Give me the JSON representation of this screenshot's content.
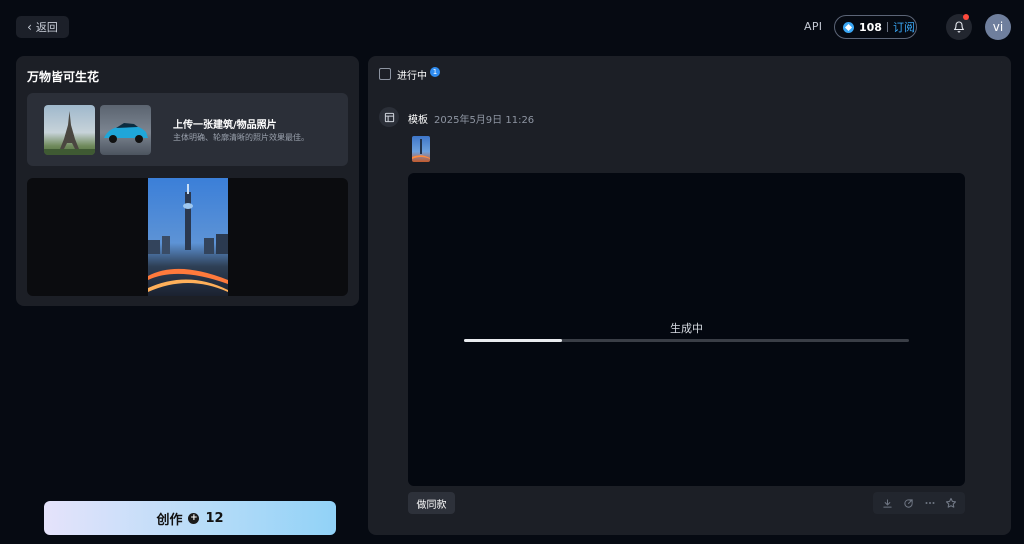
{
  "header": {
    "back_label": "返回",
    "api_label": "API",
    "credits": "108",
    "subscribe_label": "订阅",
    "avatar_initials": "vi"
  },
  "left_panel": {
    "title": "万物皆可生花",
    "upload": {
      "title": "上传一张建筑/物品照片",
      "description": "主体明确、轮廓清晰的照片效果最佳。"
    },
    "create_button": {
      "label": "创作",
      "cost": "12"
    }
  },
  "right_panel": {
    "in_progress_label": "进行中",
    "in_progress_count": "1",
    "task": {
      "type_label": "模板",
      "timestamp": "2025年5月9日 11:26",
      "status_text": "生成中",
      "progress": 0.22,
      "make_same_label": "做同款"
    }
  },
  "colors": {
    "accent": "#3aa7f5",
    "notification_dot": "#ff4a3d",
    "badge": "#2f8cf0"
  },
  "icons": {
    "back": "chevron-left-icon",
    "credit": "credit-gem-icon",
    "bell": "bell-icon",
    "template": "layout-icon",
    "plus": "plus-circle-icon",
    "actions": [
      "download-icon",
      "share-icon",
      "more-icon",
      "star-icon"
    ]
  }
}
